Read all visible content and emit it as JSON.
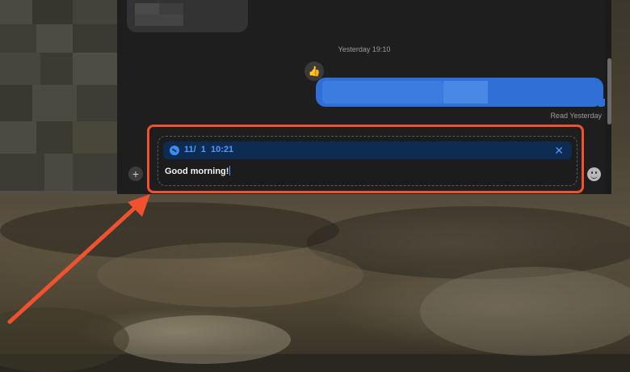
{
  "conversation": {
    "timestamp": "Yesterday 19:10",
    "reaction_emoji": "👍",
    "read_status": "Read Yesterday"
  },
  "composer": {
    "reply_date": "11/  1  10:21",
    "close_symbol": "✕",
    "message_text": "Good morning!",
    "plus_symbol": "+"
  },
  "icons": {
    "reply_banner": "clock-icon",
    "close": "close-icon",
    "attach": "plus-icon",
    "emoji": "emoji-icon"
  },
  "colors": {
    "sent_bubble": "#2f6fd6",
    "reply_banner": "#0e2b52",
    "reply_text": "#4a9bff",
    "annotation": "#f0522f"
  }
}
